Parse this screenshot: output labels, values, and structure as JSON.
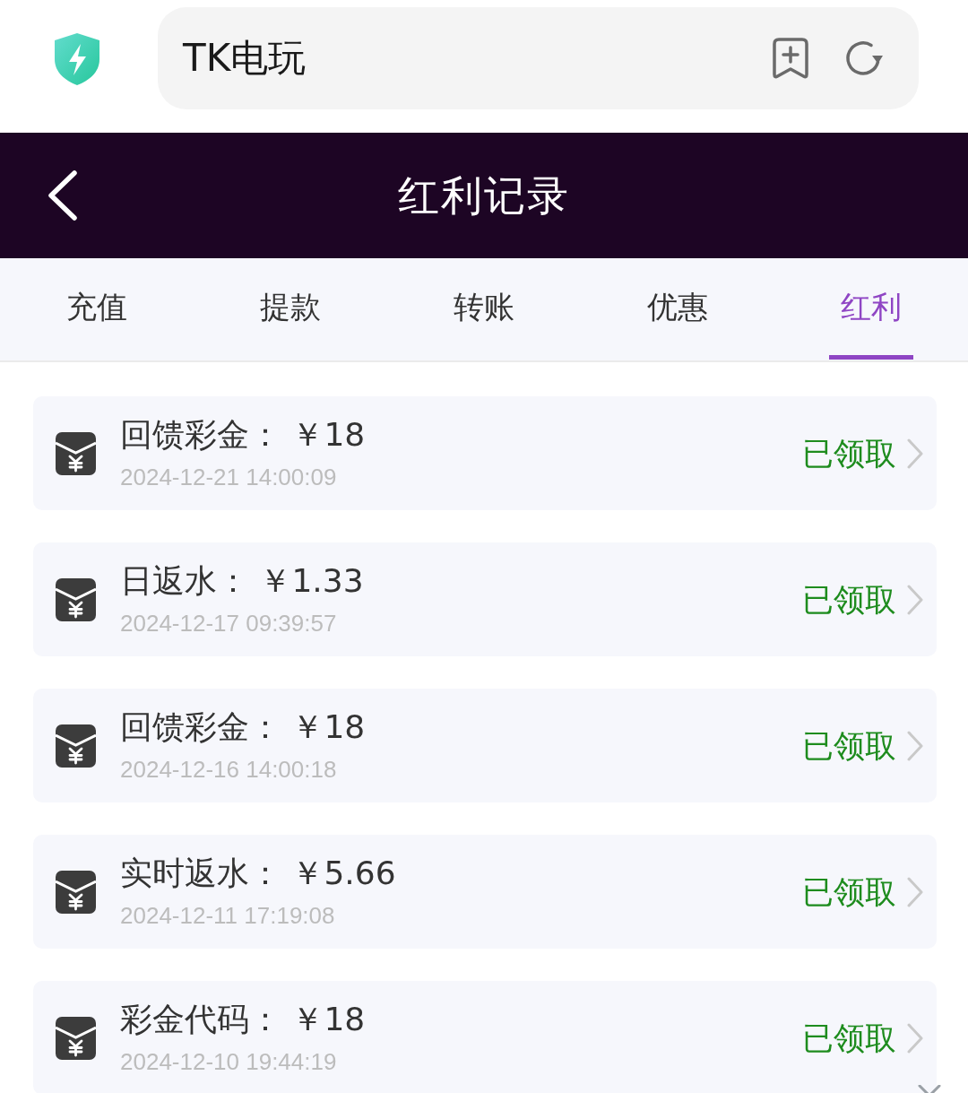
{
  "browser": {
    "address": "TK电玩"
  },
  "header": {
    "title": "红利记录"
  },
  "tabs": [
    {
      "label": "充值",
      "selected": false
    },
    {
      "label": "提款",
      "selected": false
    },
    {
      "label": "转账",
      "selected": false
    },
    {
      "label": "优惠",
      "selected": false
    },
    {
      "label": "红利",
      "selected": true
    }
  ],
  "records": [
    {
      "title": "回馈彩金： ￥18",
      "time": "2024-12-21 14:00:09",
      "status": "已领取"
    },
    {
      "title": "日返水： ￥1.33",
      "time": "2024-12-17 09:39:57",
      "status": "已领取"
    },
    {
      "title": "回馈彩金： ￥18",
      "time": "2024-12-16 14:00:18",
      "status": "已领取"
    },
    {
      "title": "实时返水： ￥5.66",
      "time": "2024-12-11 17:19:08",
      "status": "已领取"
    },
    {
      "title": "彩金代码： ￥18",
      "time": "2024-12-10 19:44:19",
      "status": "已领取"
    }
  ]
}
